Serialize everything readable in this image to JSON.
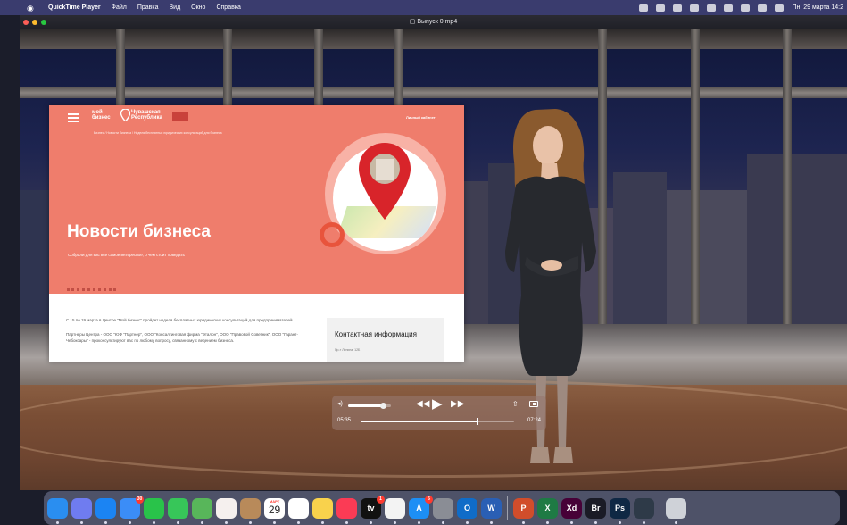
{
  "menubar": {
    "app_name": "QuickTime Player",
    "items": [
      "Файл",
      "Правка",
      "Вид",
      "Окно",
      "Справка"
    ],
    "datetime": "Пн, 29 марта 14:2"
  },
  "window": {
    "title": "Выпуск 0.mp4"
  },
  "slide": {
    "logo_line1": "мой",
    "logo_line2": "бизнес",
    "logo_region": "Чувашская Республика",
    "cabinet_link": "Личный кабинет",
    "breadcrumbs": "Бизнес  /  Новости бизнеса  /  Неделя бесплатных юридических консультаций для бизнеса",
    "hero_title": "Новости бизнеса",
    "hero_subtitle": "Собрали для вас всё самое интересное, о чём стоит поведать",
    "article_p1": "С 15 по 19 марта в Центре \"Мой бизнес\" пройдет неделя бесплатных юридических консультаций для предпринимателей.",
    "article_p2": "Партнеры Центра - ООО \"ЮФ \"Партнер\", ООО \"Консалтинговая фирма \"Эталон\", ООО \"Правовой Советник\", ООО \"Гарант-Чебоксары\" - проконсультируют вас по любому вопросу, связанному с ведением бизнеса.",
    "contact_title": "Контактная информация",
    "contact_address": "Пр-т Ленина, 12Б"
  },
  "player": {
    "time_elapsed": "05:35",
    "time_remaining": "07:24",
    "volume_level": 0.82,
    "progress": 0.76
  },
  "dock": {
    "calendar_month": "МАРТ",
    "calendar_day": "29",
    "apps": [
      {
        "name": "finder",
        "color": "#2a8ef0",
        "label": ""
      },
      {
        "name": "launchpad",
        "color": "#6f7cf0",
        "label": ""
      },
      {
        "name": "safari",
        "color": "#1b84f3",
        "label": ""
      },
      {
        "name": "mail",
        "color": "#3b8df7",
        "label": "",
        "badge": "30"
      },
      {
        "name": "facetime",
        "color": "#29c34a",
        "label": ""
      },
      {
        "name": "messages",
        "color": "#37c659",
        "label": ""
      },
      {
        "name": "maps",
        "color": "#58b65a",
        "label": ""
      },
      {
        "name": "photos",
        "color": "#f5f0ee",
        "label": ""
      },
      {
        "name": "contacts",
        "color": "#b88a5a",
        "label": ""
      },
      {
        "name": "calendar",
        "color": "#ffffff",
        "label": ""
      },
      {
        "name": "reminders",
        "color": "#ffffff",
        "label": ""
      },
      {
        "name": "notes",
        "color": "#f9d24c",
        "label": ""
      },
      {
        "name": "music",
        "color": "#fb3b55",
        "label": ""
      },
      {
        "name": "tv",
        "color": "#111111",
        "label": "tv",
        "badge": "1"
      },
      {
        "name": "freeform",
        "color": "#f3f3f3",
        "label": ""
      },
      {
        "name": "app-store",
        "color": "#1d8ff5",
        "label": "A",
        "badge": "5"
      },
      {
        "name": "system-preferences",
        "color": "#8a8d95",
        "label": ""
      },
      {
        "name": "outlook",
        "color": "#0f6cc8",
        "label": "O"
      },
      {
        "name": "word",
        "color": "#2a5fb4",
        "label": "W"
      },
      {
        "name": "powerpoint",
        "color": "#d14d2b",
        "label": "P"
      },
      {
        "name": "excel",
        "color": "#1e7a44",
        "label": "X"
      },
      {
        "name": "adobe-xd",
        "color": "#470137",
        "label": "Xd"
      },
      {
        "name": "adobe-bridge",
        "color": "#1a1b26",
        "label": "Br"
      },
      {
        "name": "adobe-photoshop",
        "color": "#0f2844",
        "label": "Ps"
      },
      {
        "name": "quicktime",
        "color": "#2e3a48",
        "label": ""
      },
      {
        "name": "trash",
        "color": "#cfd2d8",
        "label": ""
      }
    ]
  }
}
